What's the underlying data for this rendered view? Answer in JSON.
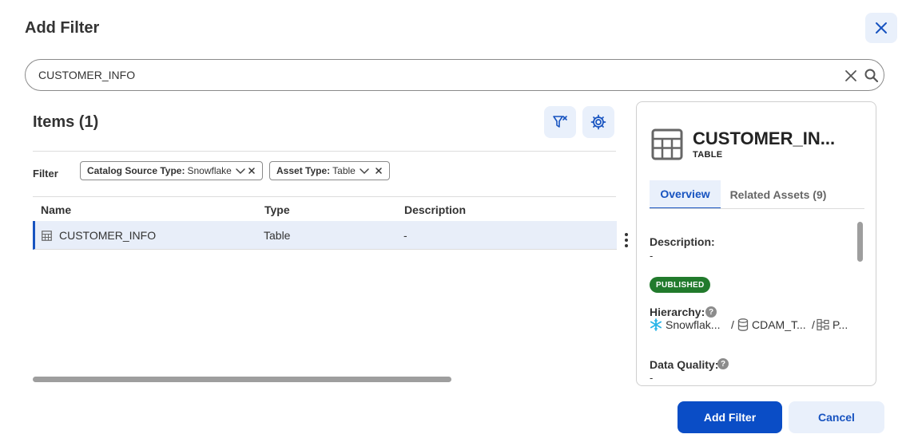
{
  "dialog": {
    "title": "Add Filter"
  },
  "search": {
    "value": "CUSTOMER_INFO",
    "placeholder": ""
  },
  "list": {
    "title": "Items (1)",
    "filter_label": "Filter",
    "chips": [
      {
        "key": "Catalog Source Type:",
        "value": "Snowflake"
      },
      {
        "key": "Asset Type:",
        "value": "Table"
      }
    ],
    "columns": [
      "Name",
      "Type",
      "Description"
    ],
    "rows": [
      {
        "name": "CUSTOMER_INFO",
        "type": "Table",
        "description": "-"
      }
    ]
  },
  "detail": {
    "name": "CUSTOMER_IN...",
    "type": "TABLE",
    "tabs": [
      "Overview",
      "Related Assets (9)"
    ],
    "description_label": "Description:",
    "description_value": "-",
    "status": "PUBLISHED",
    "hierarchy_label": "Hierarchy:",
    "hierarchy": [
      "Snowflak...",
      "/",
      "CDAM_T...",
      "/",
      "P..."
    ],
    "data_quality_label": "Data Quality:",
    "data_quality_value": "-"
  },
  "footer": {
    "primary": "Add Filter",
    "secondary": "Cancel"
  },
  "colors": {
    "accent": "#0a4dc6",
    "accent_light": "#e9f0fb",
    "published": "#217a2c"
  },
  "icons": [
    "close-icon",
    "clear-icon",
    "search-icon",
    "clear-filter-icon",
    "gear-icon",
    "chevron-down-icon",
    "table-icon",
    "kebab-icon",
    "snowflake-icon",
    "database-icon",
    "schema-icon",
    "help-icon"
  ]
}
